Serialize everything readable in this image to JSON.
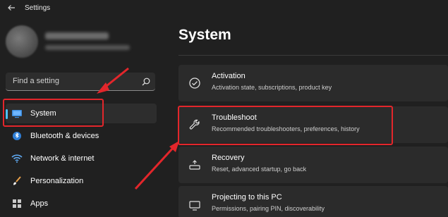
{
  "window": {
    "app_title": "Settings"
  },
  "sidebar": {
    "search": {
      "placeholder": "Find a setting"
    },
    "items": [
      {
        "label": "System",
        "icon": "display-icon",
        "selected": true
      },
      {
        "label": "Bluetooth & devices",
        "icon": "bluetooth-icon",
        "selected": false
      },
      {
        "label": "Network & internet",
        "icon": "wifi-icon",
        "selected": false
      },
      {
        "label": "Personalization",
        "icon": "paint-brush-icon",
        "selected": false
      },
      {
        "label": "Apps",
        "icon": "apps-icon",
        "selected": false
      }
    ]
  },
  "main": {
    "title": "System",
    "cards": [
      {
        "title": "Activation",
        "description": "Activation state, subscriptions, product key",
        "icon": "check-circle-icon"
      },
      {
        "title": "Troubleshoot",
        "description": "Recommended troubleshooters, preferences, history",
        "icon": "wrench-icon"
      },
      {
        "title": "Recovery",
        "description": "Reset, advanced startup, go back",
        "icon": "recovery-icon"
      },
      {
        "title": "Projecting to this PC",
        "description": "Permissions, pairing PIN, discoverability",
        "icon": "projector-icon"
      }
    ]
  },
  "colors": {
    "background": "#202020",
    "card": "#2b2b2b",
    "accent": "#4cc2ff",
    "annotation_red": "#e3262b"
  }
}
